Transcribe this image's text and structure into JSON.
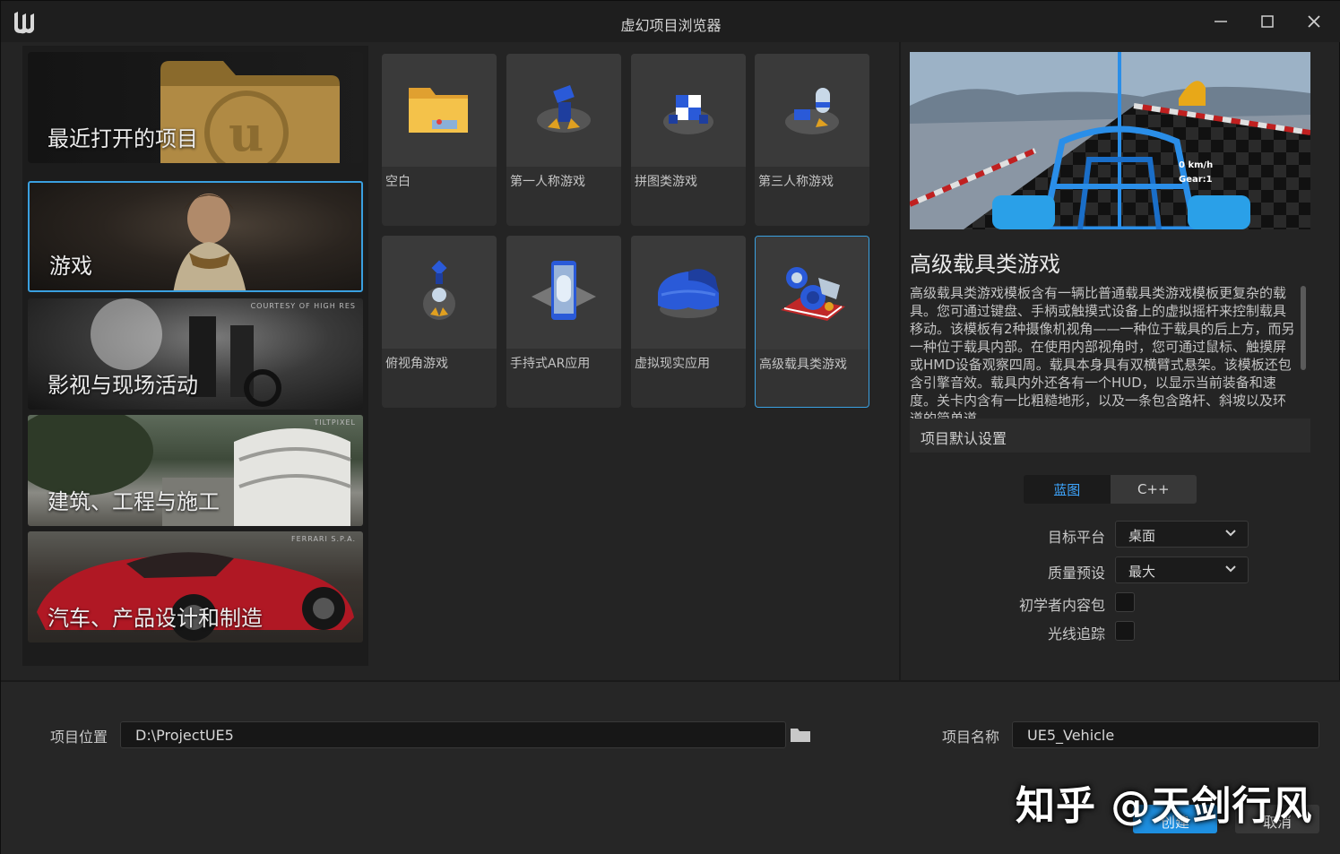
{
  "window": {
    "title": "虚幻项目浏览器",
    "controls": [
      "minimize",
      "maximize",
      "close"
    ]
  },
  "left": {
    "recent_label": "最近打开的项目",
    "categories": [
      {
        "label": "游戏",
        "credit": "",
        "selected": true
      },
      {
        "label": "影视与现场活动",
        "credit": "COURTESY OF HIGH RES",
        "selected": false
      },
      {
        "label": "建筑、工程与施工",
        "credit": "TILTPIXEL",
        "selected": false
      },
      {
        "label": "汽车、产品设计和制造",
        "credit": "FERRARI S.P.A.",
        "selected": false
      }
    ]
  },
  "templates": [
    {
      "label": "空白",
      "icon": "blank-template-icon",
      "selected": false
    },
    {
      "label": "第一人称游戏",
      "icon": "first-person-template-icon",
      "selected": false
    },
    {
      "label": "拼图类游戏",
      "icon": "puzzle-template-icon",
      "selected": false
    },
    {
      "label": "第三人称游戏",
      "icon": "third-person-template-icon",
      "selected": false
    },
    {
      "label": "俯视角游戏",
      "icon": "top-down-template-icon",
      "selected": false
    },
    {
      "label": "手持式AR应用",
      "icon": "handheld-ar-template-icon",
      "selected": false
    },
    {
      "label": "虚拟现实应用",
      "icon": "vr-template-icon",
      "selected": false
    },
    {
      "label": "高级载具类游戏",
      "icon": "vehicle-advanced-template-icon",
      "selected": true
    }
  ],
  "details": {
    "preview_hud": {
      "speed": "0 km/h",
      "gear": "Gear:1"
    },
    "title": "高级载具类游戏",
    "description": "高级载具类游戏模板含有一辆比普通载具类游戏模板更复杂的载具。您可通过键盘、手柄或触摸式设备上的虚拟摇杆来控制载具移动。该模板有2种摄像机视角——一种位于载具的后上方，而另一种位于载具内部。在使用内部视角时，您可通过鼠标、触摸屏或HMD设备观察四周。载具本身具有双横臂式悬架。该模板还包含引擎音效。载具内外还各有一个HUD，以显示当前装备和速度。关卡内含有一比粗糙地形，以及一条包含路杆、斜坡以及环道的简单道",
    "settings_header": "项目默认设置",
    "lang_tabs": [
      {
        "label": "蓝图",
        "active": true
      },
      {
        "label": "C++",
        "active": false
      }
    ],
    "target_platform": {
      "label": "目标平台",
      "value": "桌面"
    },
    "quality_preset": {
      "label": "质量预设",
      "value": "最大"
    },
    "starter_content": {
      "label": "初学者内容包",
      "checked": false
    },
    "raytracing": {
      "label": "光线追踪",
      "checked": false
    }
  },
  "bottom": {
    "location_label": "项目位置",
    "location_value": "D:\\ProjectUE5",
    "name_label": "项目名称",
    "name_value": "UE5_Vehicle",
    "create_label": "创建",
    "cancel_label": "取消"
  },
  "watermark": "知乎 @天剑行风",
  "colors": {
    "accent": "#1e8fe0",
    "selection": "#3aa0e0",
    "background": "#242424"
  }
}
